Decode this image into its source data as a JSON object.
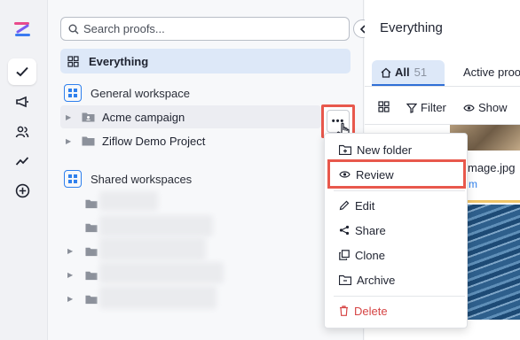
{
  "sidebar_rail": {
    "logo": "ziflow-logo",
    "items": [
      {
        "icon": "checkmark-icon",
        "active": true
      },
      {
        "icon": "megaphone-icon",
        "active": false
      },
      {
        "icon": "people-icon",
        "active": false
      },
      {
        "icon": "trend-icon",
        "active": false
      },
      {
        "icon": "plus-circle-icon",
        "active": false
      }
    ]
  },
  "panel": {
    "search": {
      "placeholder": "Search proofs..."
    },
    "everything_label": "Everything",
    "general_workspace": {
      "label": "General workspace",
      "projects": [
        {
          "label": "Acme campaign"
        },
        {
          "label": "Ziflow Demo Project"
        }
      ]
    },
    "shared_workspaces": {
      "label": "Shared workspaces"
    }
  },
  "main": {
    "title": "Everything",
    "tabs": [
      {
        "label": "All",
        "count": "51"
      },
      {
        "label": "Active proo"
      }
    ],
    "toolbar": {
      "filter_label": "Filter",
      "show_label": "Show"
    },
    "card": {
      "name": "mage.jpg",
      "sub": "m"
    }
  },
  "context_menu": {
    "items": [
      {
        "label": "New folder",
        "icon": "folder-plus-icon"
      },
      {
        "label": "Review",
        "icon": "eye-icon"
      },
      {
        "label": "Edit",
        "icon": "pencil-icon"
      },
      {
        "label": "Share",
        "icon": "share-icon"
      },
      {
        "label": "Clone",
        "icon": "clone-icon"
      },
      {
        "label": "Archive",
        "icon": "archive-folder-icon"
      },
      {
        "label": "Delete",
        "icon": "trash-icon"
      }
    ]
  },
  "colors": {
    "accent": "#2f80ed",
    "highlight": "#e8584c",
    "selected_bg": "#dde8f8",
    "danger": "#d64545"
  }
}
